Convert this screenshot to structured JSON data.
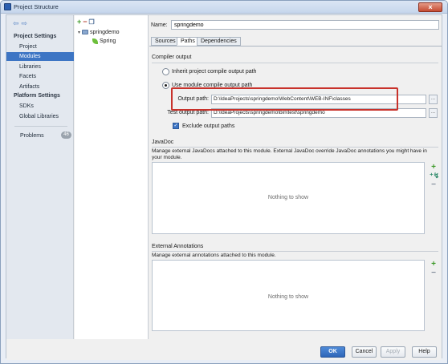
{
  "window": {
    "title": "Project Structure",
    "close_glyph": "×"
  },
  "sidebar": {
    "project_settings_heading": "Project Settings",
    "project_settings_items": [
      "Project",
      "Modules",
      "Libraries",
      "Facets",
      "Artifacts"
    ],
    "selected_item": "Modules",
    "platform_settings_heading": "Platform Settings",
    "platform_settings_items": [
      "SDKs",
      "Global Libraries"
    ],
    "problems_label": "Problems",
    "problems_count": "46",
    "selected_color": "#3d75c4"
  },
  "tree": {
    "toolbar_icons": [
      "add-icon",
      "remove-icon",
      "copy-icon"
    ],
    "nodes": [
      {
        "label": "springdemo",
        "icon": "module-folder-icon",
        "expanded": true
      },
      {
        "label": "Spring",
        "icon": "spring-leaf-icon"
      }
    ]
  },
  "detail": {
    "name_label": "Name:",
    "name_value": "springdemo",
    "tabs": [
      "Sources",
      "Paths",
      "Dependencies"
    ],
    "active_tab": "Paths",
    "compiler_output": {
      "heading": "Compiler output",
      "inherit_label": "Inherit project compile output path",
      "use_module_label": "Use module compile output path",
      "selected": "use_module",
      "output_path_label": "Output path:",
      "output_path_value": "D:\\IdeaProjects\\springdemo\\WebContent\\WEB-INF\\classes",
      "test_output_path_label": "Test output path:",
      "test_output_path_value": "D:\\IdeaProjects\\springdemo\\bin\\test\\springdemo",
      "browse_label": "...",
      "exclude_label": "Exclude output paths",
      "exclude_checked": true,
      "highlight_color": "#c8322b"
    },
    "javadoc": {
      "heading": "JavaDoc",
      "description": "Manage external JavaDocs attached to this module. External JavaDoc override JavaDoc annotations you might have in your module.",
      "empty_text": "Nothing to show"
    },
    "external_annotations": {
      "heading": "External Annotations",
      "description": "Manage external annotations attached to this module.",
      "empty_text": "Nothing to show"
    }
  },
  "footer": {
    "ok": "OK",
    "cancel": "Cancel",
    "apply": "Apply",
    "help": "Help"
  }
}
